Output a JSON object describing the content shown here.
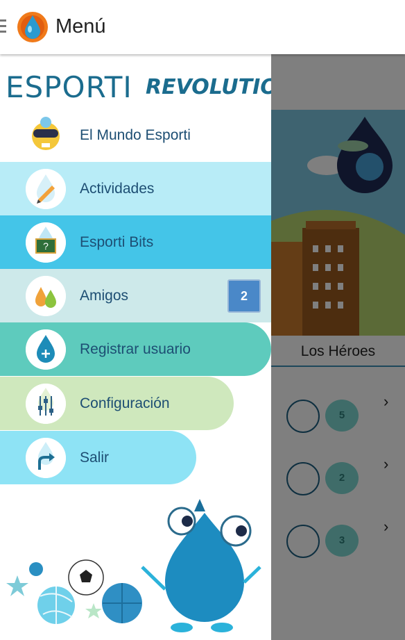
{
  "appbar": {
    "title": "Menú"
  },
  "drawer": {
    "logo_word": "ESPORTI",
    "logo_subword": "REVOLUTION",
    "items": [
      {
        "label": "El Mundo Esporti",
        "bg": "#ffffff"
      },
      {
        "label": "Actividades",
        "bg": "#b8ecf7"
      },
      {
        "label": "Esporti Bits",
        "bg": "#44c5e8"
      },
      {
        "label": "Amigos",
        "bg": "#cde9ea",
        "badge": "2"
      },
      {
        "label": "Registrar usuario",
        "bg": "#5ecbbd"
      },
      {
        "label": "Configuración",
        "bg": "#cfe8bd"
      },
      {
        "label": "Salir",
        "bg": "#8ee3f5"
      }
    ]
  },
  "content": {
    "tab_label": "Los Héroes",
    "heroes": [
      {
        "count": "5"
      },
      {
        "count": "2"
      },
      {
        "count": "3"
      }
    ]
  },
  "colors": {
    "accent": "#1b6c8e",
    "badge": "#4a88c8",
    "overlay": "rgba(0,0,0,0.5)"
  }
}
